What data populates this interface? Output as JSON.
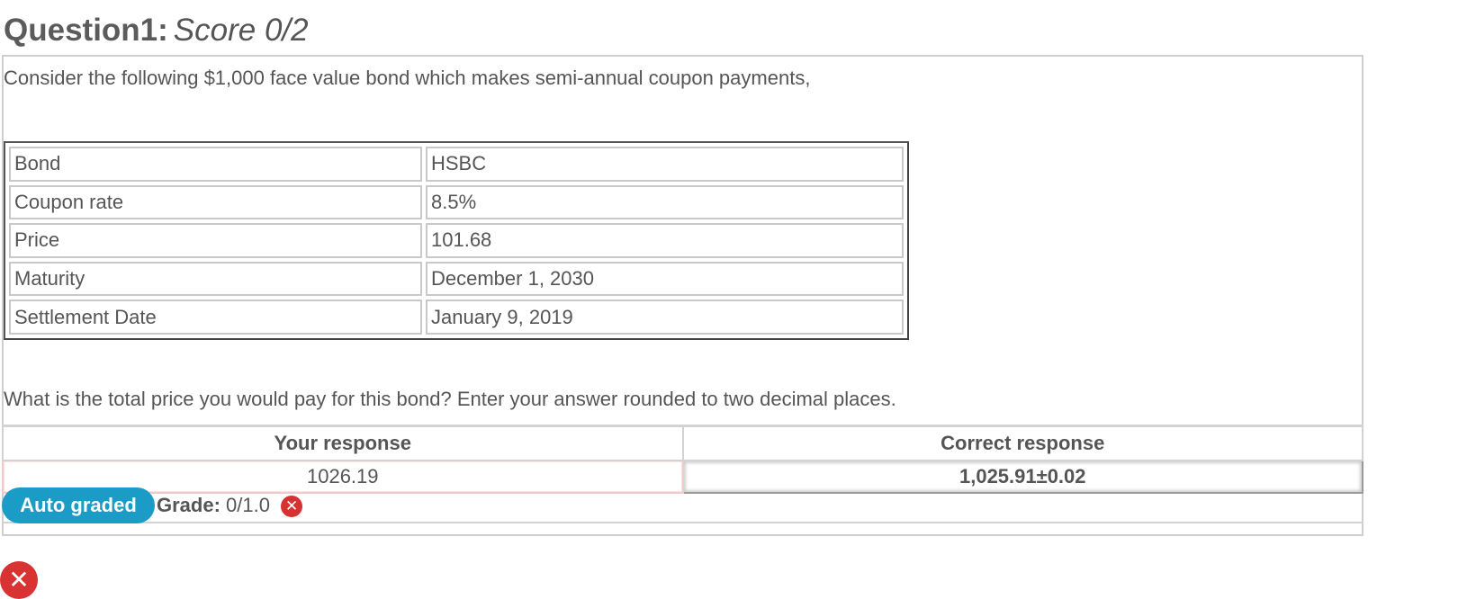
{
  "question": {
    "title": "Question1:",
    "score": "Score 0/2",
    "intro": "Consider the following $1,000 face value bond which makes semi-annual coupon payments,",
    "prompt": "What is the total price you would pay for this bond?  Enter your answer rounded to two decimal places."
  },
  "bond_table": [
    {
      "label": "Bond",
      "value": "HSBC"
    },
    {
      "label": "Coupon rate",
      "value": "8.5%"
    },
    {
      "label": "Price",
      "value": "101.68"
    },
    {
      "label": "Maturity",
      "value": "December 1, 2030"
    },
    {
      "label": "Settlement Date",
      "value": "January 9, 2019"
    }
  ],
  "responses": {
    "your_header": "Your response",
    "correct_header": "Correct response",
    "your_value": "1026.19",
    "correct_value": "1,025.91±0.02"
  },
  "grading": {
    "badge": "Auto graded",
    "grade_label": "Grade:",
    "grade_value": "0/1.0",
    "status_icon": "x-circle-icon"
  },
  "colors": {
    "badge_bg": "#1a9cc7",
    "incorrect_red": "#d73232",
    "your_response_border": "#f3caca"
  }
}
